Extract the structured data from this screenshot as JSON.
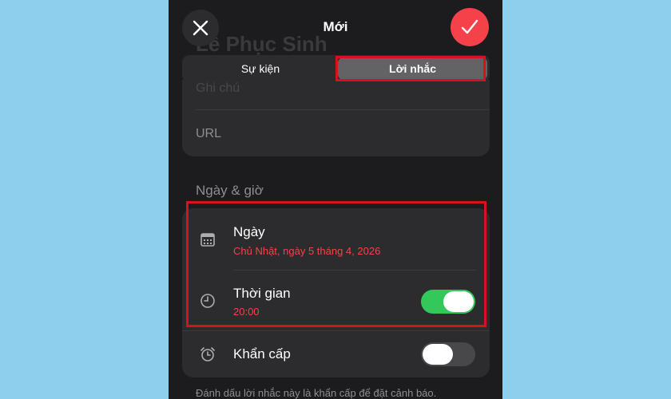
{
  "header": {
    "title": "Mới",
    "close_icon": "close-icon",
    "done_icon": "checkmark-icon"
  },
  "background_title": "Lễ Phục Sinh",
  "segments": [
    {
      "label": "Sự kiện",
      "selected": false
    },
    {
      "label": "Lời nhắc",
      "selected": true
    }
  ],
  "details": {
    "note_placeholder": "Ghi chú",
    "url_placeholder": "URL"
  },
  "date_time": {
    "section_label": "Ngày & giờ",
    "date": {
      "label": "Ngày",
      "value": "Chủ Nhật, ngày 5 tháng 4, 2026",
      "icon": "calendar-icon"
    },
    "time": {
      "label": "Thời gian",
      "value": "20:00",
      "icon": "clock-icon",
      "enabled": true
    },
    "urgent": {
      "label": "Khẩn cấp",
      "icon": "alarm-icon",
      "enabled": false
    }
  },
  "footer_text": "Đánh dấu lời nhắc này là khẩn cấp để đặt cảnh báo.",
  "colors": {
    "accent_red": "#f5424a",
    "toggle_on": "#34c759",
    "toggle_off": "#48484a",
    "highlight_box": "#d6131c"
  }
}
